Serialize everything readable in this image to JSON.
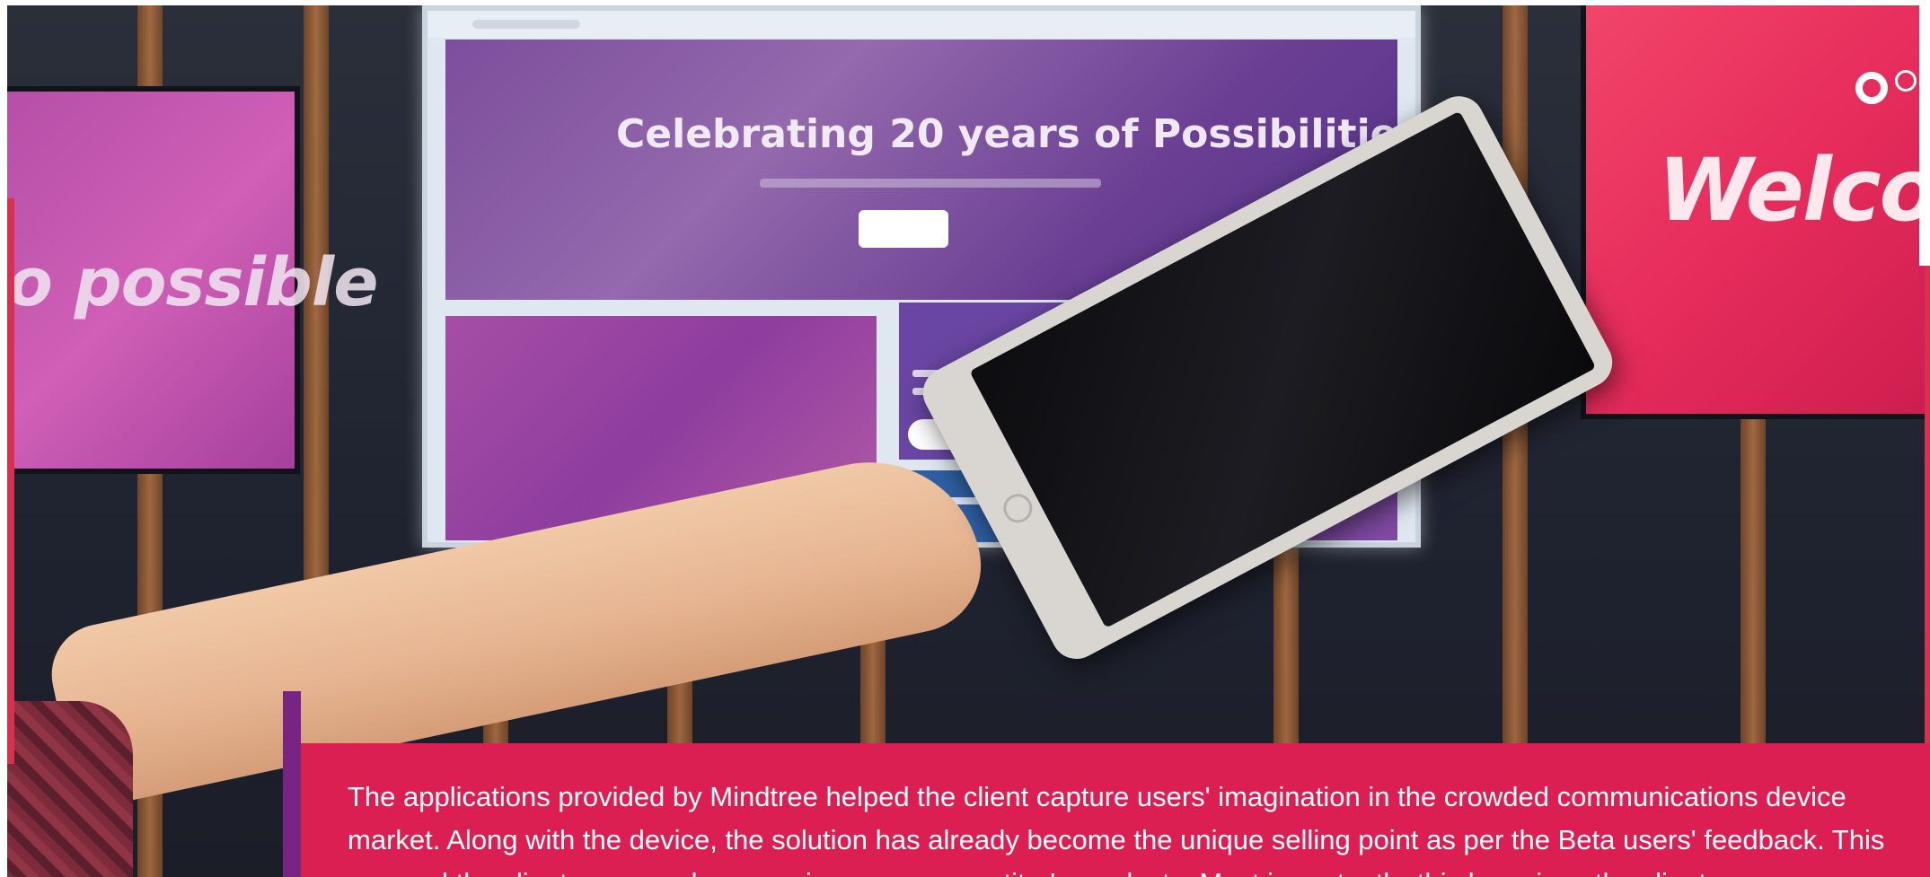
{
  "hero": {
    "screen_left_text": "o possible",
    "screen_right_text": "Welcom",
    "screen_center_headline": "Celebrating 20 years of Possibilities"
  },
  "slider": {
    "dots": [
      "active",
      "inactive"
    ]
  },
  "caption": {
    "text": "The applications provided by Mindtree helped the client capture users' imagination in the crowded communications device market. Along with the device, the solution has already become the unique selling point as per the Beta users' feedback. This ensured the client commands a premium over competitor's products. Most importantly, this has given the client a new"
  },
  "colors": {
    "caption_bg": "#dc1f53",
    "caption_accent": "#772484",
    "accent_red": "#d8304f"
  },
  "icons": {
    "slider_active": "ring-icon",
    "slider_inactive": "circle-outline-icon"
  }
}
